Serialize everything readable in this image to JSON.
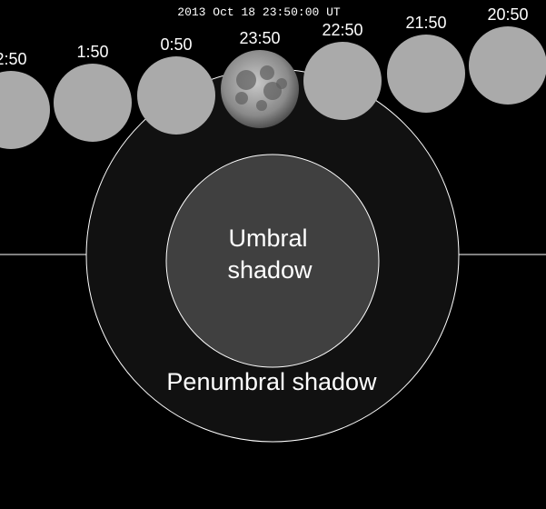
{
  "title": "2013 Oct 18 23:50:00 UT",
  "shadows": {
    "umbral_line1": "Umbral",
    "umbral_line2": "shadow",
    "penumbral": "Penumbral shadow"
  },
  "moons": [
    {
      "label": "2:50",
      "current": false
    },
    {
      "label": "1:50",
      "current": false
    },
    {
      "label": "0:50",
      "current": false
    },
    {
      "label": "23:50",
      "current": true
    },
    {
      "label": "22:50",
      "current": false
    },
    {
      "label": "21:50",
      "current": false
    },
    {
      "label": "20:50",
      "current": false
    }
  ],
  "colors": {
    "background": "#000000",
    "penumbra": "#111111",
    "umbra": "#404040",
    "moon_position": "#aaaaaa",
    "lines": "#ffffff"
  }
}
